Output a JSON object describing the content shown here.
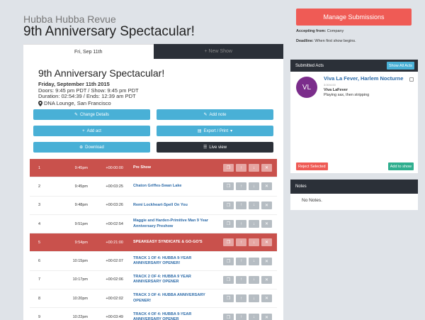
{
  "header": {
    "org": "Hubba Hubba Revue",
    "title": "9th Anniversary Spectacular!"
  },
  "tabs": [
    {
      "label": "Fri, Sep 11th",
      "active": true
    },
    {
      "label": "+ New Show",
      "active": false
    }
  ],
  "show": {
    "title": "9th Anniversary Spectacular!",
    "date": "Friday, September 11th 2015",
    "doors": "Doors: 9:45 pm PDT / Show: 9:45 pm PDT",
    "duration": "Duration: 02:54:39 / Ends: 12:39 am PDT",
    "venue": "DNA Lounge, San Francisco"
  },
  "buttons": {
    "change_details": "Change Details",
    "add_note": "Add note",
    "add_act": "Add act",
    "export_print": "Export / Print",
    "download": "Download",
    "live_view": "Live view"
  },
  "rows": [
    {
      "num": "1",
      "time": "9:45pm",
      "offset": "+00:00:00",
      "act": "Pre Show",
      "highlight": true
    },
    {
      "num": "2",
      "time": "9:45pm",
      "offset": "+00:03:25",
      "act": "Chaton Griffes-Swan Lake",
      "highlight": false
    },
    {
      "num": "3",
      "time": "9:48pm",
      "offset": "+00:03:26",
      "act": "Remi Lockheart-Spell On You",
      "highlight": false
    },
    {
      "num": "4",
      "time": "9:51pm",
      "offset": "+00:02:54",
      "act": "Maggie and Harden-Primitive Man 9 Year Anniversary Preshow",
      "highlight": false
    },
    {
      "num": "5",
      "time": "9:54pm",
      "offset": "+00:21:00",
      "act": "SPEAKEASY SYNDICATE & GO-GO'S",
      "highlight": true
    },
    {
      "num": "6",
      "time": "10:15pm",
      "offset": "+00:02:07",
      "act": "TRACK 1 OF 4: HUBBA 9-YEAR ANNIVERSARY OPENER!",
      "highlight": false
    },
    {
      "num": "7",
      "time": "10:17pm",
      "offset": "+00:02:06",
      "act": "TRACK 2 OF 4: HUBBA 9 YEAR ANNIVERSARY OPENER",
      "highlight": false
    },
    {
      "num": "8",
      "time": "10:20pm",
      "offset": "+00:02:02",
      "act": "TRACK 3 OF 4: HUBBA ANNIVERSARY OPENER!",
      "highlight": false
    },
    {
      "num": "9",
      "time": "10:22pm",
      "offset": "+00:03:49",
      "act": "TRACK 4 OF 4: HUBBA 9-YEAR ANNIVERSARY OPENER",
      "highlight": false
    }
  ],
  "sidebar": {
    "manage_label": "Manage Submissions",
    "accepting_key": "Accepting from:",
    "accepting_value": "Company",
    "deadline_key": "Deadline:",
    "deadline_value": "When first show begins.",
    "submitted_title": "Submitted Acts",
    "show_all": "Show All Acts",
    "act": {
      "initials": "VL",
      "name": "Viva La Fever, Harlem Nocturne",
      "tag": "3:00/4:00",
      "performer": "Viva LaFever",
      "description": "Playing sax, then stripping"
    },
    "reject": "Reject Selected",
    "add_to_show": "Add to show",
    "notes_title": "Notes",
    "no_notes": "No Notes."
  },
  "colors": {
    "accent_red": "#ef5b55",
    "highlight_row": "#c9514c",
    "blue": "#49b0d6",
    "dark": "#2b3038",
    "teal": "#2fae8e",
    "avatar": "#7b2d8b"
  }
}
